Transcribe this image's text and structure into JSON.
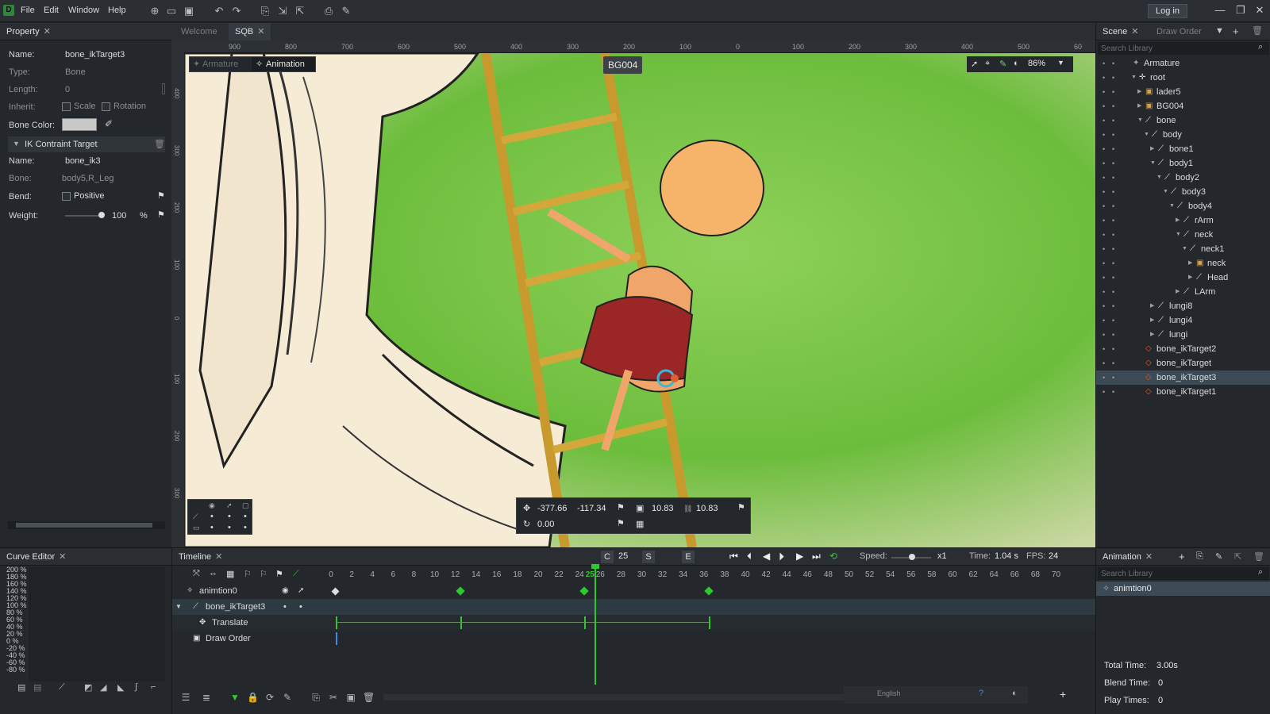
{
  "menubar": {
    "logo": "D",
    "items": [
      "File",
      "Edit",
      "Window",
      "Help"
    ],
    "login_label": "Log in"
  },
  "property": {
    "tab_label": "Property",
    "name_label": "Name:",
    "name_value": "bone_ikTarget3",
    "type_label": "Type:",
    "type_value": "Bone",
    "length_label": "Length:",
    "length_value": "0",
    "inherit_label": "Inherit:",
    "scale_label": "Scale",
    "rotation_label": "Rotation",
    "bone_color_label": "Bone Color:",
    "ik_section_label": "IK Contraint Target",
    "ik_name_label": "Name:",
    "ik_name_value": "bone_ik3",
    "ik_bone_label": "Bone:",
    "ik_bone_value": "body5,R_Leg",
    "bend_label": "Bend:",
    "bend_positive_label": "Positive",
    "weight_label": "Weight:",
    "weight_value": "100",
    "weight_unit": "%"
  },
  "viewport": {
    "tabs": [
      {
        "label": "Welcome",
        "active": false
      },
      {
        "label": "SQB",
        "active": true
      }
    ],
    "mode_armature": "Armature",
    "mode_animation": "Animation",
    "bg_label": "BG004",
    "zoom": "86%",
    "ruler_top": [
      "900",
      "800",
      "700",
      "600",
      "500",
      "400",
      "300",
      "200",
      "100",
      "0",
      "100",
      "200",
      "300",
      "400",
      "500",
      "60"
    ],
    "ruler_left": [
      "400",
      "300",
      "200",
      "100",
      "0",
      "100",
      "200",
      "300"
    ],
    "transform": {
      "x": "-377.66",
      "y": "-117.34",
      "scale_x": "10.83",
      "scale_y": "10.83",
      "rotation": "0.00"
    }
  },
  "scene": {
    "tabs": [
      "Scene",
      "Draw Order"
    ],
    "search_placeholder": "Search Library",
    "tree": [
      {
        "label": "Armature",
        "indent": 0,
        "icon": "armature",
        "arrow": ""
      },
      {
        "label": "root",
        "indent": 1,
        "icon": "root",
        "arrow": "▼"
      },
      {
        "label": "lader5",
        "indent": 2,
        "icon": "image",
        "arrow": "▶"
      },
      {
        "label": "BG004",
        "indent": 2,
        "icon": "image",
        "arrow": "▶"
      },
      {
        "label": "bone",
        "indent": 2,
        "icon": "bone",
        "arrow": "▼"
      },
      {
        "label": "body",
        "indent": 3,
        "icon": "bone",
        "arrow": "▼"
      },
      {
        "label": "bone1",
        "indent": 4,
        "icon": "bone",
        "arrow": "▶"
      },
      {
        "label": "body1",
        "indent": 4,
        "icon": "bone",
        "arrow": "▼"
      },
      {
        "label": "body2",
        "indent": 5,
        "icon": "bone",
        "arrow": "▼"
      },
      {
        "label": "body3",
        "indent": 6,
        "icon": "bone",
        "arrow": "▼"
      },
      {
        "label": "body4",
        "indent": 7,
        "icon": "bone",
        "arrow": "▼"
      },
      {
        "label": "rArm",
        "indent": 8,
        "icon": "bone",
        "arrow": "▶"
      },
      {
        "label": "neck",
        "indent": 8,
        "icon": "bone",
        "arrow": "▼"
      },
      {
        "label": "neck1",
        "indent": 9,
        "icon": "bone",
        "arrow": "▼"
      },
      {
        "label": "neck",
        "indent": 10,
        "icon": "image",
        "arrow": "▶"
      },
      {
        "label": "Head",
        "indent": 10,
        "icon": "bone",
        "arrow": "▶"
      },
      {
        "label": "LArm",
        "indent": 8,
        "icon": "bone",
        "arrow": "▶"
      },
      {
        "label": "lungi8",
        "indent": 4,
        "icon": "bone",
        "arrow": "▶"
      },
      {
        "label": "lungi4",
        "indent": 4,
        "icon": "bone",
        "arrow": "▶"
      },
      {
        "label": "lungi",
        "indent": 4,
        "icon": "bone",
        "arrow": "▶"
      },
      {
        "label": "bone_ikTarget2",
        "indent": 2,
        "icon": "ik",
        "arrow": ""
      },
      {
        "label": "bone_ikTarget",
        "indent": 2,
        "icon": "ik",
        "arrow": ""
      },
      {
        "label": "bone_ikTarget3",
        "indent": 2,
        "icon": "ik",
        "arrow": "",
        "selected": true
      },
      {
        "label": "bone_ikTarget1",
        "indent": 2,
        "icon": "ik",
        "arrow": ""
      }
    ]
  },
  "curve": {
    "tab_label": "Curve Editor",
    "percent_labels": [
      "200 %",
      "180 %",
      "160 %",
      "140 %",
      "120 %",
      "100 %",
      "80 %",
      "60 %",
      "40 %",
      "20 %",
      "0 %",
      "-20 %",
      "-40 %",
      "-60 %",
      "-80 %"
    ]
  },
  "timeline": {
    "tab_label": "Timeline",
    "current_label": "C",
    "current_frame": "25",
    "s_label": "S",
    "e_label": "E",
    "speed_label": "Speed:",
    "speed_value": "x1",
    "time_label": "Time:",
    "time_value": "1.04 s",
    "fps_label": "FPS:",
    "fps_value": "24",
    "frames": [
      "0",
      "2",
      "4",
      "6",
      "8",
      "10",
      "12",
      "14",
      "16",
      "18",
      "20",
      "22",
      "24",
      "25",
      "26",
      "28",
      "30",
      "32",
      "34",
      "36",
      "38",
      "40",
      "42",
      "44",
      "46",
      "48",
      "50",
      "52",
      "54",
      "56",
      "58",
      "60",
      "62",
      "64",
      "66",
      "68",
      "70"
    ],
    "tracks": [
      {
        "label": "animtion0",
        "indent": 0
      },
      {
        "label": "bone_ikTarget3",
        "indent": 1
      },
      {
        "label": "Translate",
        "indent": 2
      },
      {
        "label": "Draw Order",
        "indent": 1
      }
    ],
    "status_lang": "English"
  },
  "animation": {
    "tab_label": "Animation",
    "search_placeholder": "Search Library",
    "items": [
      "animtion0"
    ],
    "total_time_label": "Total Time:",
    "total_time_value": "3.00s",
    "blend_time_label": "Blend Time:",
    "blend_time_value": "0",
    "play_times_label": "Play Times:",
    "play_times_value": "0"
  },
  "colors": {
    "accent_green": "#2ec92e",
    "selection": "#3b4a55",
    "panel_bg": "#24282c",
    "ik_orange": "#e0622a"
  }
}
